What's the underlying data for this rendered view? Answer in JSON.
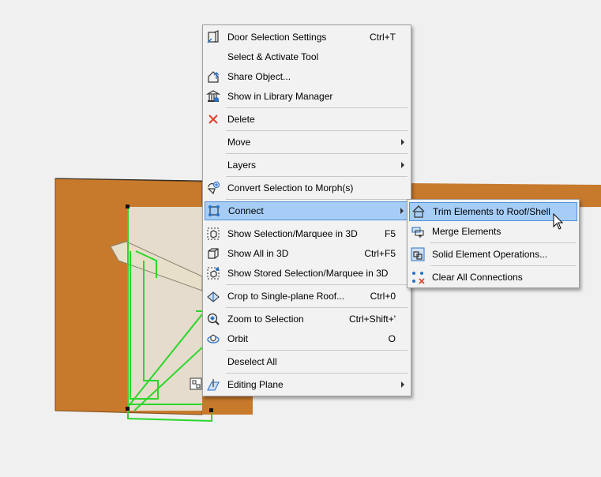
{
  "main_menu": {
    "items": [
      {
        "label": "Door Selection Settings",
        "shortcut": "Ctrl+T",
        "icon": "door-settings-icon"
      },
      {
        "label": "Select & Activate Tool",
        "shortcut": "",
        "icon": ""
      },
      {
        "label": "Share Object...",
        "shortcut": "",
        "icon": "share-object-icon"
      },
      {
        "label": "Show in Library Manager",
        "shortcut": "",
        "icon": "library-manager-icon"
      },
      {
        "label": "Delete",
        "shortcut": "",
        "icon": "delete-x-icon"
      },
      {
        "label": "Move",
        "shortcut": "",
        "icon": "",
        "submenu": true
      },
      {
        "label": "Layers",
        "shortcut": "",
        "icon": "",
        "submenu": true
      },
      {
        "label": "Convert Selection to Morph(s)",
        "shortcut": "",
        "icon": "morph-convert-icon"
      },
      {
        "label": "Connect",
        "shortcut": "",
        "icon": "connect-icon",
        "submenu": true,
        "highlighted": true
      },
      {
        "label": "Show Selection/Marquee in 3D",
        "shortcut": "F5",
        "icon": "show-selection-3d-icon"
      },
      {
        "label": "Show All in 3D",
        "shortcut": "Ctrl+F5",
        "icon": "show-all-3d-icon"
      },
      {
        "label": "Show Stored Selection/Marquee in 3D",
        "shortcut": "",
        "icon": "stored-selection-3d-icon"
      },
      {
        "label": "Crop to Single-plane Roof...",
        "shortcut": "Ctrl+0",
        "icon": "crop-roof-icon"
      },
      {
        "label": "Zoom to Selection",
        "shortcut": "Ctrl+Shift+'",
        "icon": "zoom-selection-icon"
      },
      {
        "label": "Orbit",
        "shortcut": "O",
        "icon": "orbit-icon"
      },
      {
        "label": "Deselect All",
        "shortcut": "",
        "icon": ""
      },
      {
        "label": "Editing Plane",
        "shortcut": "",
        "icon": "editing-plane-icon",
        "submenu": true
      }
    ]
  },
  "sub_menu": {
    "items": [
      {
        "label": "Trim Elements to Roof/Shell",
        "icon": "trim-roof-icon",
        "highlighted": true
      },
      {
        "label": "Merge Elements",
        "icon": "merge-elements-icon"
      },
      {
        "label": "Solid Element Operations...",
        "icon": "solid-operations-icon"
      },
      {
        "label": "Clear All Connections",
        "icon": "clear-connections-icon"
      }
    ]
  },
  "colors": {
    "wall_orange": "#c87a2c",
    "selection_green": "#2bd62b",
    "highlight": "#a6cdf6",
    "delete_red": "#e04028"
  }
}
